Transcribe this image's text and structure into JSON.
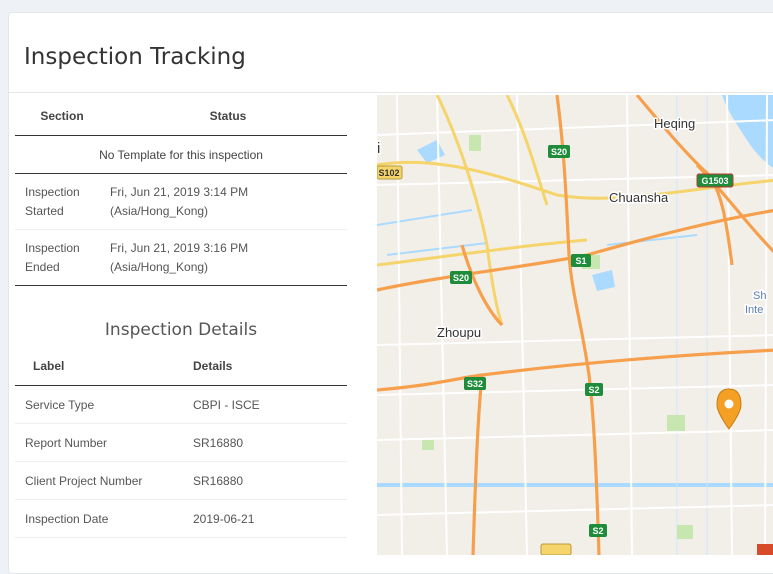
{
  "page": {
    "title": "Inspection Tracking"
  },
  "status_table": {
    "headers": [
      "Section",
      "Status"
    ],
    "no_template": "No Template for this inspection",
    "rows": [
      {
        "label": "Inspection Started",
        "value": "Fri, Jun 21, 2019 3:14 PM (Asia/Hong_Kong)"
      },
      {
        "label": "Inspection Ended",
        "value": "Fri, Jun 21, 2019 3:16 PM (Asia/Hong_Kong)"
      }
    ]
  },
  "details": {
    "title": "Inspection Details",
    "headers": [
      "Label",
      "Details"
    ],
    "rows": [
      {
        "label": "Service Type",
        "value": "CBPI - ISCE"
      },
      {
        "label": "Report Number",
        "value": "SR16880"
      },
      {
        "label": "Client Project Number",
        "value": "SR16880"
      },
      {
        "label": "Inspection Date",
        "value": "2019-06-21"
      }
    ]
  },
  "map": {
    "places": [
      "Heqing",
      "Chuansha",
      "Zhoupu",
      "Sh",
      "Inte",
      "i"
    ],
    "shields": [
      "S20",
      "S102",
      "G1503",
      "S1",
      "S20",
      "S32",
      "S2",
      "S2"
    ],
    "marker_icon": "map-pin-icon",
    "colors": {
      "land": "#f2efe9",
      "water": "#aadaff",
      "highway": "#f6a04d",
      "trunk": "#f5d46b",
      "shield_green": "#1e8c3a",
      "marker": "#f4a024"
    }
  }
}
